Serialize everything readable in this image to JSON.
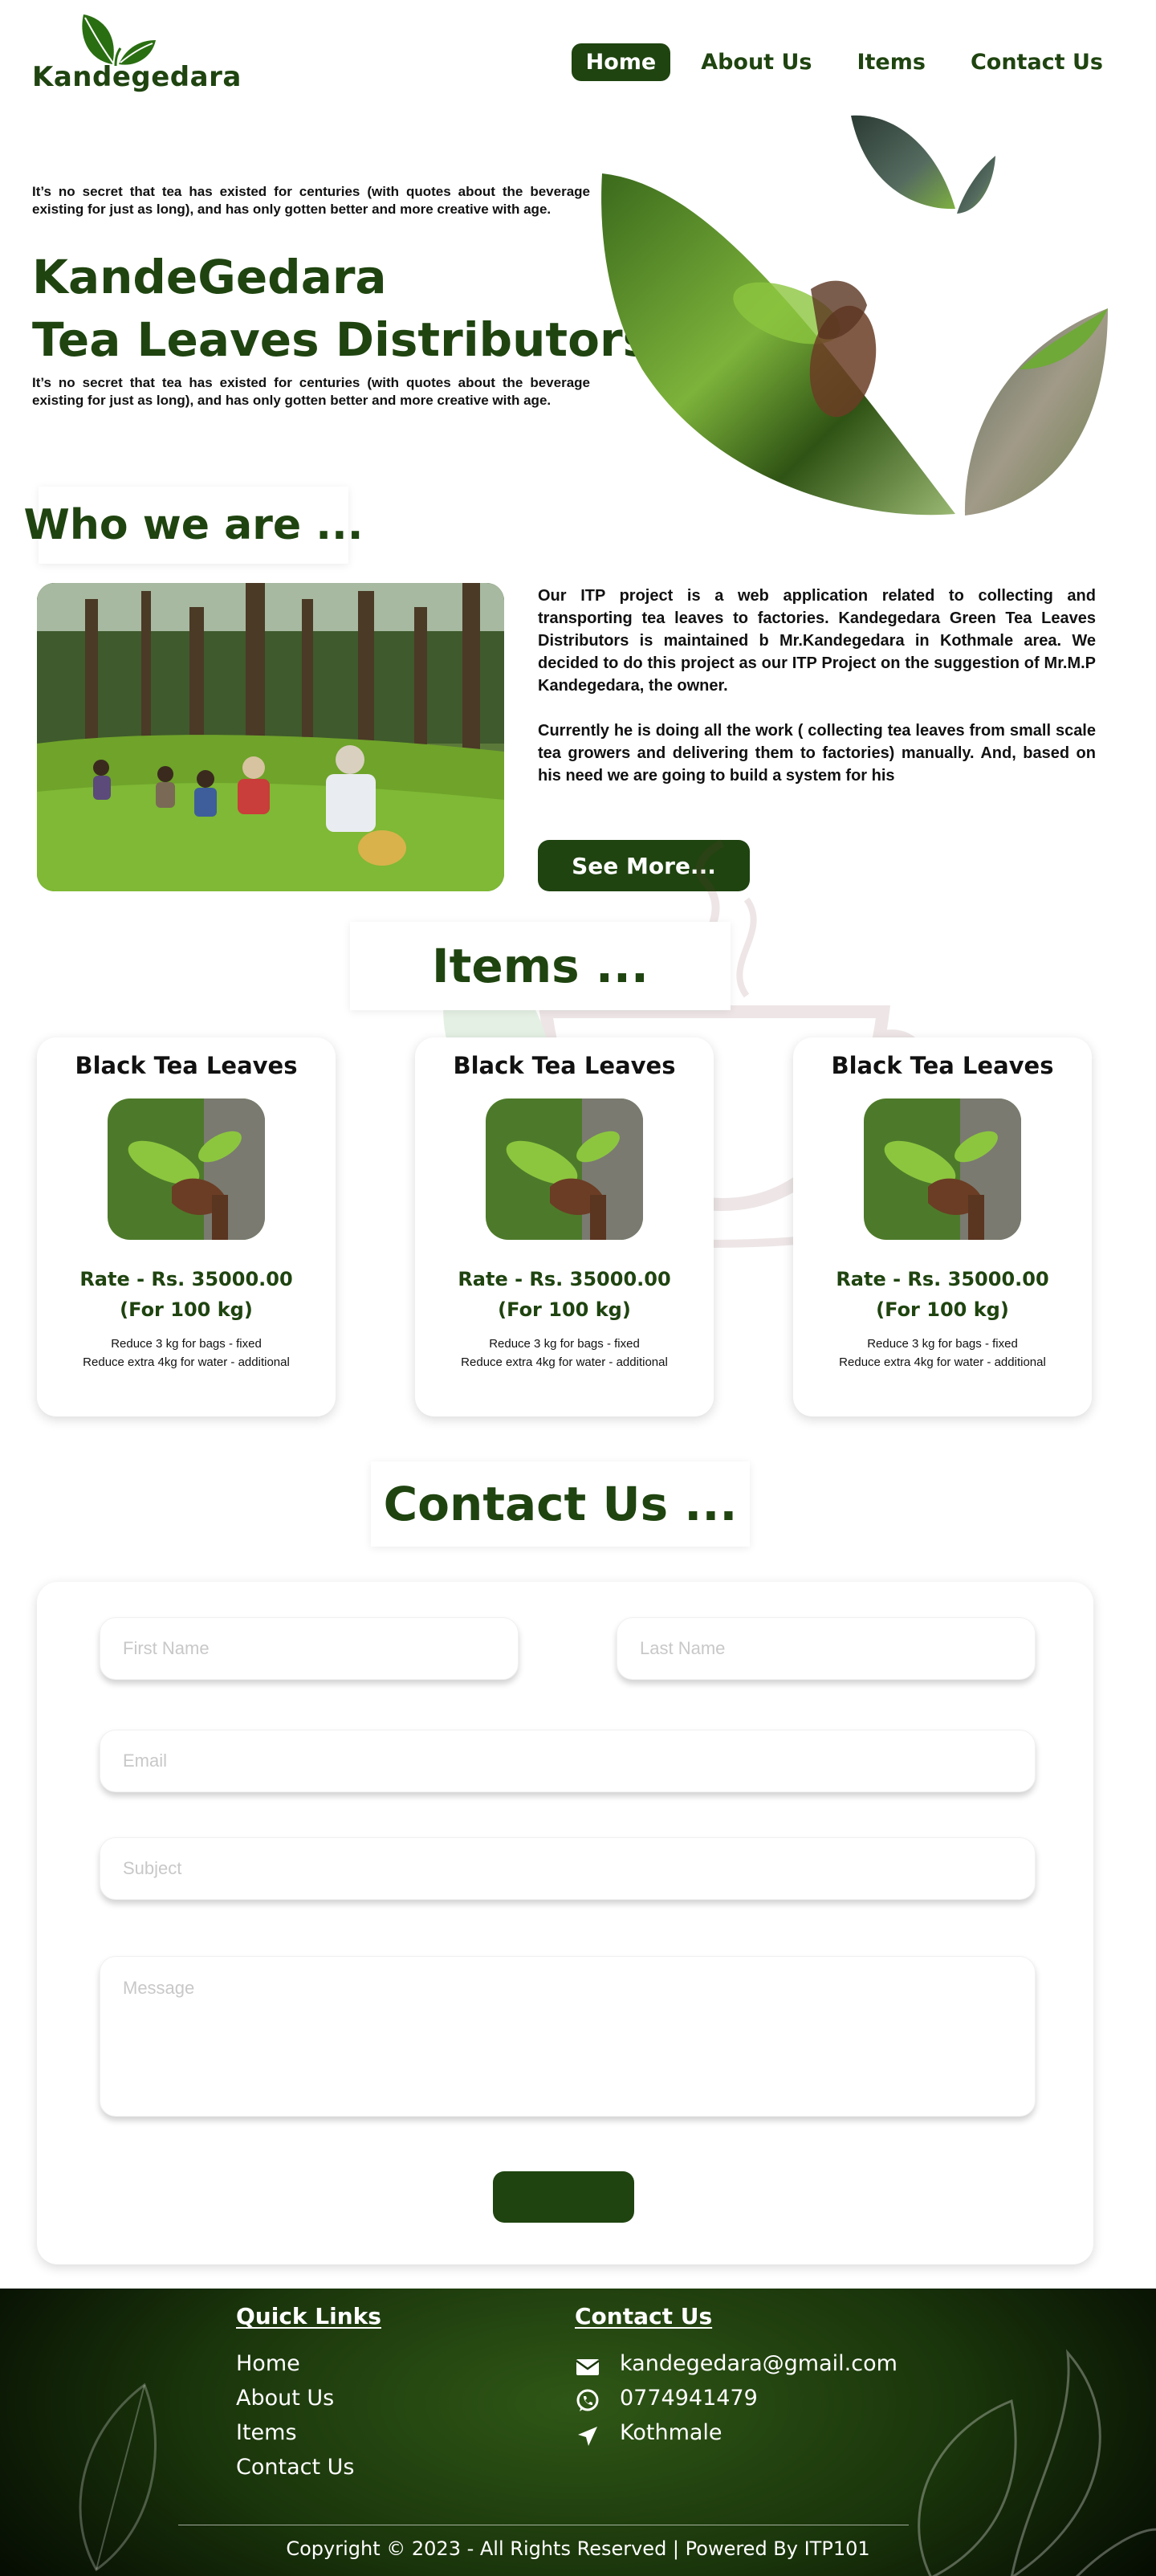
{
  "brand": {
    "name": "Kandegedara",
    "color": "#1f4410"
  },
  "nav": {
    "items": [
      {
        "label": "Home",
        "active": true
      },
      {
        "label": "About Us",
        "active": false
      },
      {
        "label": "Items",
        "active": false
      },
      {
        "label": "Contact Us",
        "active": false
      }
    ]
  },
  "hero": {
    "intro": "It’s no secret that tea has existed for centuries (with quotes about the beverage existing for just as long), and has only gotten better and more creative with age.",
    "title_line1": "KandeGedara",
    "title_line2": "Tea Leaves Distributors",
    "outro": "It’s no secret that tea has existed for centuries (with quotes about the beverage existing for just as long), and has only gotten better and more creative with age."
  },
  "about": {
    "heading": "Who we are ...",
    "paragraph1": "Our ITP project is a web application related to collecting and transporting tea leaves to factories. Kandegedara Green Tea Leaves Distributors is maintained b Mr.Kandegedara in Kothmale area. We decided to do this project as our ITP Project on the suggestion of Mr.M.P Kandegedara, the owner.",
    "paragraph2": "Currently he is doing all the work ( collecting tea leaves from small scale tea growers and delivering them to factories) manually. And, based on his need we are going to build a system for his",
    "see_more_label": "See More..."
  },
  "items": {
    "heading": "Items ...",
    "cards": [
      {
        "title": "Black Tea Leaves",
        "rate": "Rate - Rs. 35000.00",
        "unit": "(For 100 kg)",
        "note1": "Reduce 3 kg for bags - fixed",
        "note2": "Reduce extra 4kg for water - additional"
      },
      {
        "title": "Black Tea Leaves",
        "rate": "Rate - Rs. 35000.00",
        "unit": "(For 100 kg)",
        "note1": "Reduce 3 kg for bags - fixed",
        "note2": "Reduce extra 4kg for water - additional"
      },
      {
        "title": "Black Tea Leaves",
        "rate": "Rate - Rs. 35000.00",
        "unit": "(For 100 kg)",
        "note1": "Reduce 3 kg for bags - fixed",
        "note2": "Reduce extra 4kg for water - additional"
      }
    ]
  },
  "contact": {
    "heading": "Contact Us ...",
    "first_name_placeholder": "First Name",
    "last_name_placeholder": "Last Name",
    "email_placeholder": "Email",
    "subject_placeholder": "Subject",
    "message_placeholder": "Message",
    "submit_label": ""
  },
  "footer": {
    "quick_links_heading": "Quick Links",
    "quick_links": [
      "Home",
      "About Us",
      "Items",
      "Contact Us"
    ],
    "contact_heading": "Contact Us",
    "email": "kandegedara@gmail.com",
    "phone": "0774941479",
    "location": "Kothmale",
    "icons": [
      "envelope-icon",
      "whatsapp-icon",
      "location-arrow-icon"
    ],
    "copyright": "Copyright © 2023 - All Rights Reserved | Powered By ITP101"
  }
}
